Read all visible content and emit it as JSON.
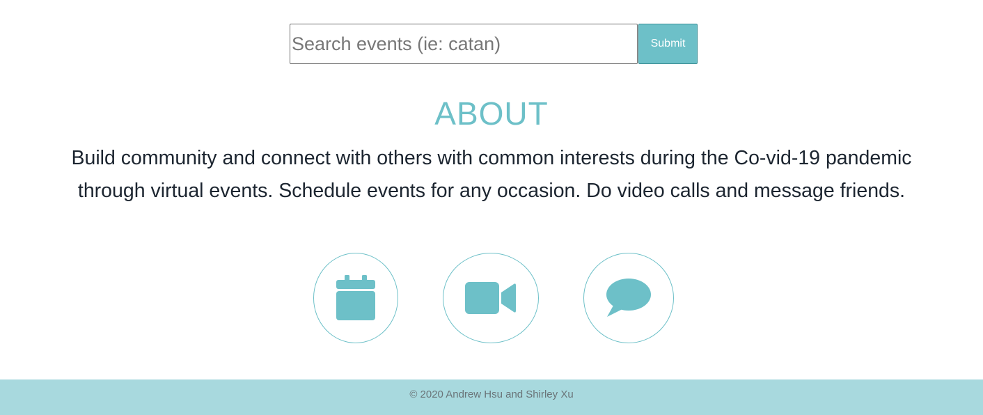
{
  "search": {
    "placeholder": "Search events (ie: catan)",
    "value": "",
    "submit_label": "Submit"
  },
  "about": {
    "title": "ABOUT",
    "line1": "Build community and connect with others with common interests during the Co-vid-19 pandemic",
    "line2": "through virtual events. Schedule events for any occasion. Do video calls and message friends."
  },
  "features": [
    {
      "icon": "calendar-icon"
    },
    {
      "icon": "video-camera-icon"
    },
    {
      "icon": "chat-bubble-icon"
    }
  ],
  "footer": {
    "text": "© 2020 Andrew Hsu and Shirley Xu"
  },
  "colors": {
    "accent": "#6dc0c8",
    "footer_bg": "#a8d9de",
    "body_text": "#1c2530"
  }
}
